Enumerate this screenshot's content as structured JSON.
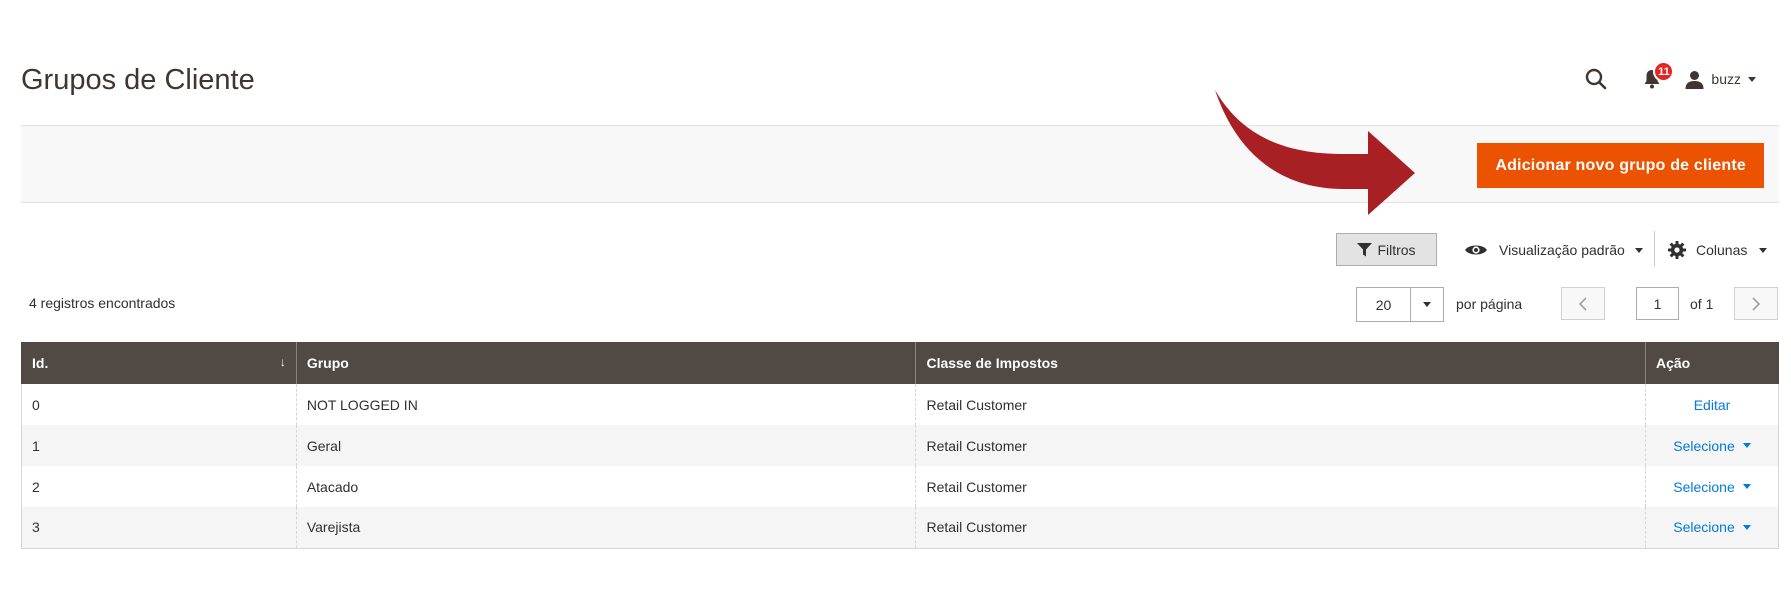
{
  "header": {
    "title": "Grupos de Cliente",
    "notifications_count": "11",
    "user_name": "buzz"
  },
  "action_bar": {
    "add_button_label": "Adicionar novo grupo de cliente"
  },
  "toolbar": {
    "filters_label": "Filtros",
    "view_label": "Visualização padrão",
    "columns_label": "Colunas"
  },
  "records_found": "4 registros encontrados",
  "pager": {
    "per_page_value": "20",
    "per_page_label": "por página",
    "current_page": "1",
    "of_label": "of 1"
  },
  "table": {
    "columns": [
      "Id.",
      "Grupo",
      "Classe de Impostos",
      "Ação"
    ],
    "rows": [
      {
        "id": "0",
        "group": "NOT LOGGED IN",
        "tax_class": "Retail Customer",
        "action": "Editar"
      },
      {
        "id": "1",
        "group": "Geral",
        "tax_class": "Retail Customer",
        "action": "Selecione"
      },
      {
        "id": "2",
        "group": "Atacado",
        "tax_class": "Retail Customer",
        "action": "Selecione"
      },
      {
        "id": "3",
        "group": "Varejista",
        "tax_class": "Retail Customer",
        "action": "Selecione"
      }
    ]
  },
  "icons": {
    "search": "search-icon",
    "notifications": "bell-icon",
    "user": "user-icon",
    "filter": "filter-icon",
    "view": "eye-icon",
    "columns": "gear-icon"
  },
  "colors": {
    "primary_button": "#eb5202",
    "table_header": "#514943",
    "link": "#007bdb",
    "annotation_arrow": "#a81f24",
    "badge": "#e22626"
  }
}
